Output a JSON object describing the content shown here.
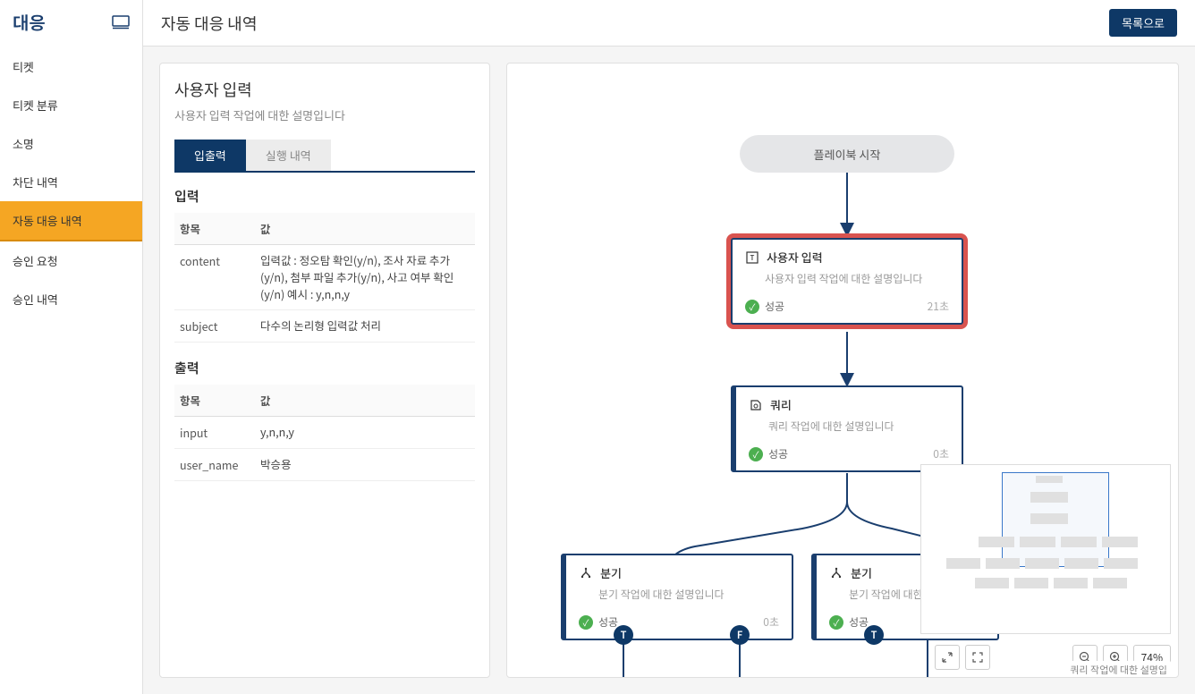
{
  "sidebar": {
    "title": "대응",
    "items": [
      {
        "label": "티켓"
      },
      {
        "label": "티켓 분류"
      },
      {
        "label": "소명"
      },
      {
        "label": "차단 내역"
      },
      {
        "label": "자동 대응 내역",
        "active": true
      },
      {
        "label": "승인 요청"
      },
      {
        "label": "승인 내역"
      }
    ]
  },
  "header": {
    "title": "자동 대응 내역",
    "list_button": "목록으로"
  },
  "detail": {
    "title": "사용자 입력",
    "desc": "사용자 입력 작업에 대한 설명입니다",
    "tabs": [
      {
        "label": "입출력",
        "active": true
      },
      {
        "label": "실행 내역"
      }
    ],
    "input_section": "입력",
    "input_header_key": "항목",
    "input_header_val": "값",
    "input_rows": [
      {
        "key": "content",
        "val": "입력값 : 정오탐 확인(y/n), 조사 자료 추가(y/n), 첨부 파일 추가(y/n), 사고 여부 확인(y/n) 예시 : y,n,n,y"
      },
      {
        "key": "subject",
        "val": "다수의 논리형 입력값 처리"
      }
    ],
    "output_section": "출력",
    "output_header_key": "항목",
    "output_header_val": "값",
    "output_rows": [
      {
        "key": "input",
        "val": "y,n,n,y"
      },
      {
        "key": "user_name",
        "val": "박승용"
      }
    ]
  },
  "canvas": {
    "start_label": "플레이북 시작",
    "nodes": {
      "user_input": {
        "title": "사용자 입력",
        "desc": "사용자 입력 작업에 대한 설명입니다",
        "status": "성공",
        "time": "21초"
      },
      "query": {
        "title": "쿼리",
        "desc": "쿼리 작업에 대한 설명입니다",
        "status": "성공",
        "time": "0초"
      },
      "branch_left": {
        "title": "분기",
        "desc": "분기 작업에 대한 설명입니다",
        "status": "성공",
        "time": "0초"
      },
      "branch_right": {
        "title": "분기",
        "desc": "분기 작업에 대한 설",
        "status": "성공",
        "time": ""
      }
    },
    "badges": {
      "t": "T",
      "f": "F",
      "t2": "T"
    },
    "zoom": "74%",
    "tooltip": "쿼리 작업에 대한 설명입"
  }
}
